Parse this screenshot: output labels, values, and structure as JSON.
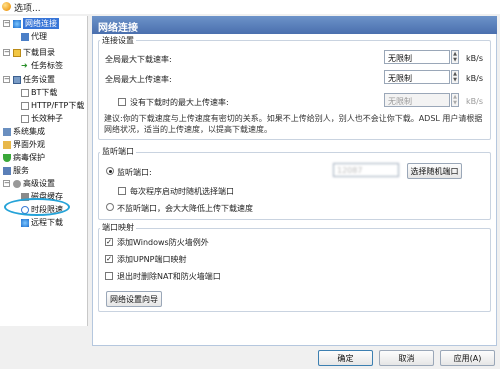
{
  "window": {
    "title": "选项..."
  },
  "tree": {
    "items": [
      {
        "label": "网络连接",
        "name": "tree-item-network"
      },
      {
        "label": "代理",
        "name": "tree-item-proxy"
      },
      {
        "label": "下载目录",
        "name": "tree-item-download-dir"
      },
      {
        "label": "任务标签",
        "name": "tree-item-task-tags"
      },
      {
        "label": "任务设置",
        "name": "tree-item-task-settings"
      },
      {
        "label": "BT下载",
        "name": "tree-item-bt"
      },
      {
        "label": "HTTP/FTP下载",
        "name": "tree-item-http-ftp"
      },
      {
        "label": "长效种子",
        "name": "tree-item-long-seed"
      },
      {
        "label": "系统集成",
        "name": "tree-item-system"
      },
      {
        "label": "界面外观",
        "name": "tree-item-appearance"
      },
      {
        "label": "病毒保护",
        "name": "tree-item-virus"
      },
      {
        "label": "服务",
        "name": "tree-item-service"
      },
      {
        "label": "高级设置",
        "name": "tree-item-advanced"
      },
      {
        "label": "磁盘缓存",
        "name": "tree-item-disk-cache"
      },
      {
        "label": "时段限速",
        "name": "tree-item-time-limit"
      },
      {
        "label": "远程下载",
        "name": "tree-item-remote"
      }
    ]
  },
  "panel": {
    "title": "网络连接",
    "conn": {
      "title": "连接设置",
      "max_down_label": "全局最大下载速率:",
      "max_down_value": "无限制",
      "max_up_label": "全局最大上传速率:",
      "max_up_value": "无限制",
      "no_task_up_label": "没有下载时的最大上传速率:",
      "no_task_up_value": "无限制",
      "unit": "kB/s",
      "hint": "建议:你的下载速度与上传速度有密切的关系。如果不上传给别人，别人也不会让你下载。ADSL 用户请根据网络状况，适当的上传速度，以提高下载速度。"
    },
    "listen": {
      "title": "监听端口",
      "port_label": "监听端口:",
      "port_value": "12087",
      "random_btn": "选择随机端口",
      "random_each_label": "每次程序启动时随机选择端口",
      "no_listen_label": "不监听端口，会大大降低上传下载速度"
    },
    "mapping": {
      "title": "端口映射",
      "fw_label": "添加Windows防火墙例外",
      "upnp_label": "添加UPNP端口映射",
      "remove_label": "退出时删除NAT和防火墙端口",
      "wizard_btn": "网络设置向导"
    }
  },
  "footer": {
    "ok": "确定",
    "cancel": "取消",
    "apply": "应用(A)"
  }
}
